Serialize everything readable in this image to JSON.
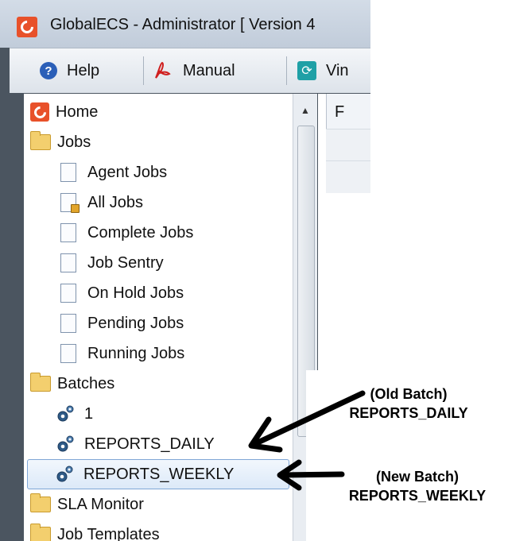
{
  "window": {
    "title": "GlobalECS - Administrator [ Version 4"
  },
  "toolbar": {
    "help_label": "Help",
    "manual_label": "Manual",
    "third_label": "Vin"
  },
  "tree": {
    "home": "Home",
    "jobs": "Jobs",
    "job_items": [
      "Agent Jobs",
      "All Jobs",
      "Complete Jobs",
      "Job Sentry",
      "On Hold Jobs",
      "Pending Jobs",
      "Running Jobs"
    ],
    "batches": "Batches",
    "batch_items": [
      "1",
      "REPORTS_DAILY",
      "REPORTS_WEEKLY"
    ],
    "selected_item": "REPORTS_WEEKLY",
    "sla_monitor": "SLA Monitor",
    "job_templates": "Job Templates"
  },
  "content": {
    "header_letter": "F"
  },
  "annotations": {
    "old_batch_line1": "(Old Batch)",
    "old_batch_line2": "REPORTS_DAILY",
    "new_batch_line1": "(New Batch)",
    "new_batch_line2": "REPORTS_WEEKLY"
  },
  "colors": {
    "brand_orange": "#e8512a",
    "selection_border": "#7fa6d6",
    "folder_yellow": "#f3cf6e"
  },
  "icons": [
    "app-logo-icon",
    "help-icon",
    "pdf-icon",
    "refresh-icon",
    "home-icon",
    "folder-icon",
    "document-icon",
    "locked-document-icon",
    "gear-icon"
  ]
}
